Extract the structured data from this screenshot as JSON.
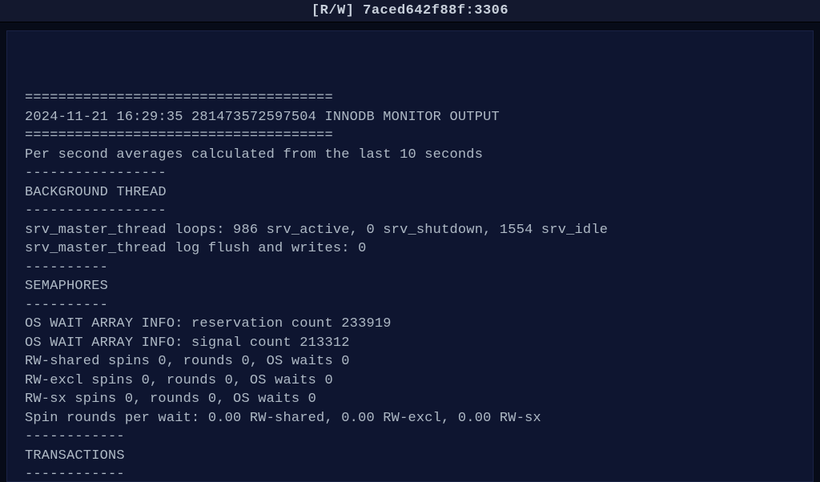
{
  "header": {
    "mode": "[R/W]",
    "host": "7aced642f88f:3306"
  },
  "terminal": {
    "lines": [
      "=====================================",
      "2024-11-21 16:29:35 281473572597504 INNODB MONITOR OUTPUT",
      "=====================================",
      "Per second averages calculated from the last 10 seconds",
      "-----------------",
      "BACKGROUND THREAD",
      "-----------------",
      "srv_master_thread loops: 986 srv_active, 0 srv_shutdown, 1554 srv_idle",
      "srv_master_thread log flush and writes: 0",
      "----------",
      "SEMAPHORES",
      "----------",
      "OS WAIT ARRAY INFO: reservation count 233919",
      "OS WAIT ARRAY INFO: signal count 213312",
      "RW-shared spins 0, rounds 0, OS waits 0",
      "RW-excl spins 0, rounds 0, OS waits 0",
      "RW-sx spins 0, rounds 0, OS waits 0",
      "Spin rounds per wait: 0.00 RW-shared, 0.00 RW-excl, 0.00 RW-sx",
      "------------",
      "TRANSACTIONS",
      "------------"
    ]
  }
}
